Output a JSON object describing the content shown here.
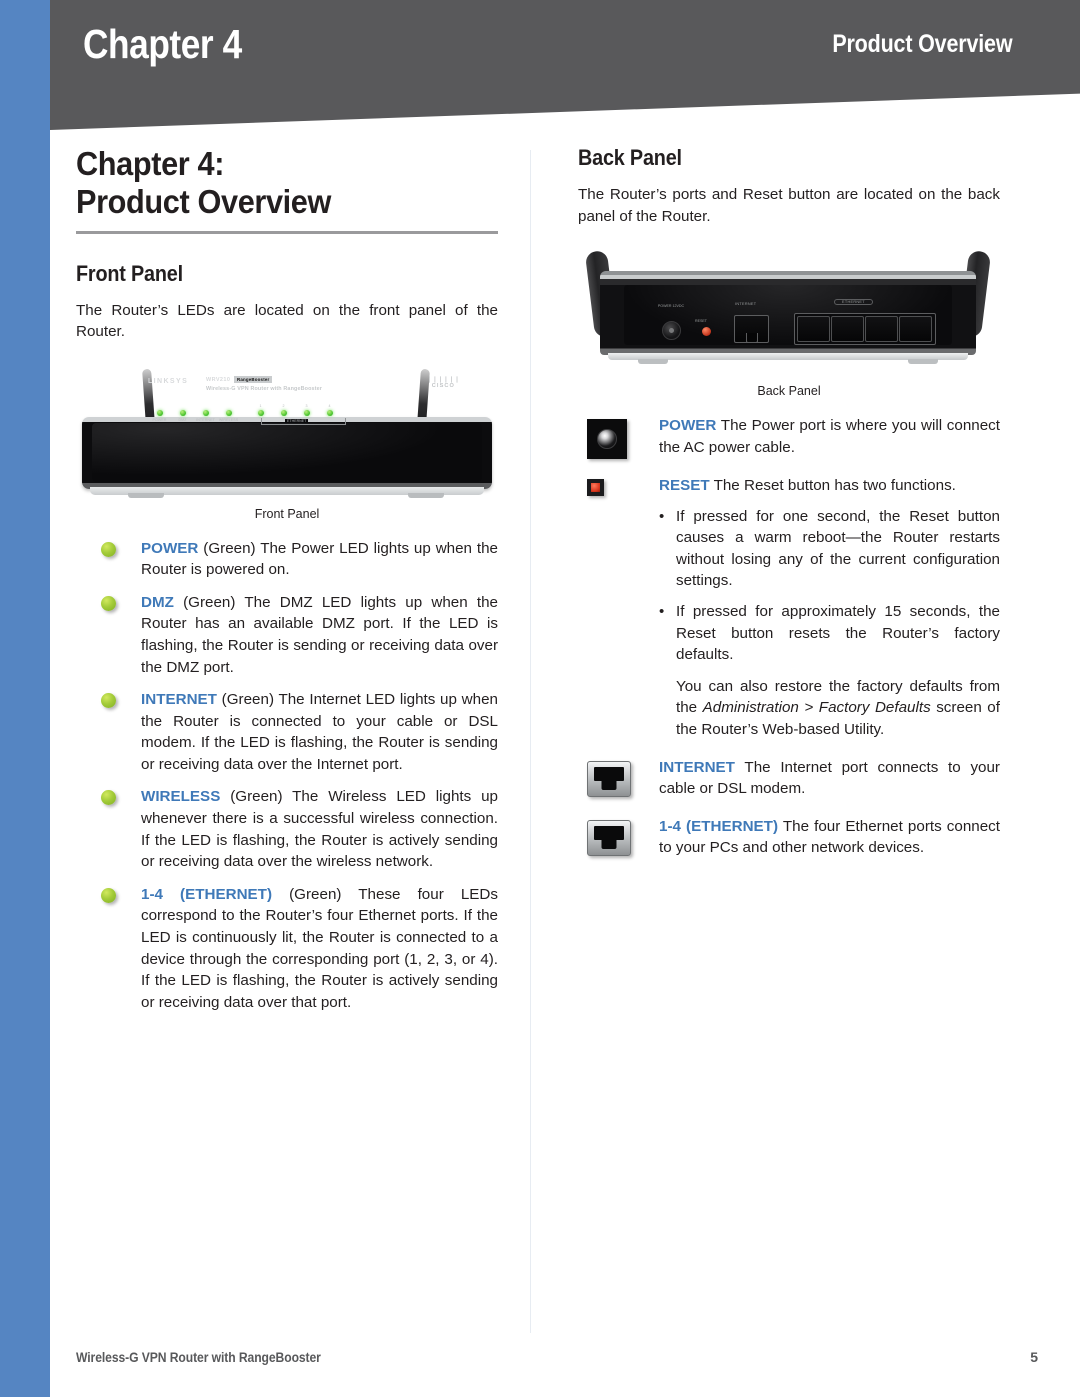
{
  "header": {
    "chapter": "Chapter 4",
    "section": "Product Overview"
  },
  "left_column": {
    "chapter_title_line1": "Chapter 4:",
    "chapter_title_line2": "Product Overview",
    "front_panel_heading": "Front Panel",
    "front_panel_intro": "The Router’s LEDs are located on the front panel of the Router.",
    "front_panel_caption": "Front Panel",
    "led_items": [
      {
        "label": "POWER",
        "text": " (Green)  The Power LED lights up when the Router is powered on."
      },
      {
        "label": "DMZ",
        "text": "  (Green)  The DMZ LED lights up when the Router has an available DMZ port. If the LED is flashing, the Router is sending or receiving data over the DMZ port."
      },
      {
        "label": "INTERNET",
        "text": " (Green) The Internet LED lights up when the Router is connected to your cable or DSL modem. If the LED is flashing, the Router is sending or receiving data over the Internet port."
      },
      {
        "label": "WIRELESS",
        "text": " (Green) The Wireless LED lights up whenever there is a successful wireless connection. If the LED is flashing, the Router is actively sending or receiving data over the wireless network."
      },
      {
        "label": "1-4  (ETHERNET)",
        "text": " (Green) These four LEDs correspond to the Router’s four Ethernet ports. If the LED is continuously lit, the Router is connected to a device through the corresponding port (1, 2, 3, or 4). If the LED is flashing, the Router is actively sending or receiving data over that port."
      }
    ]
  },
  "right_column": {
    "back_panel_heading": "Back Panel",
    "back_panel_intro": "The Router’s ports and Reset button are located on the back panel of the Router.",
    "back_panel_caption": "Back Panel",
    "port_items": [
      {
        "icon": "power-port-icon",
        "label": "POWER",
        "text": " The Power port is where you will connect the AC power cable."
      },
      {
        "icon": "reset-button-icon",
        "label": "RESET",
        "text": "  The Reset button has two functions."
      },
      {
        "icon": "rj45-internet-icon",
        "label": "INTERNET",
        "text": "  The Internet port connects to your cable or DSL modem."
      },
      {
        "icon": "rj45-ethernet-icon",
        "label": "1-4  (ETHERNET)",
        "text": " The four Ethernet ports connect to your PCs and other network devices."
      }
    ],
    "reset_bullets": [
      "If pressed for one second, the Reset button causes a warm reboot—the Router restarts without losing any of the current configuration settings.",
      "If pressed for approximately 15 seconds, the Reset button resets the Router’s factory defaults."
    ],
    "reset_note_pre": "You can also restore the factory defaults from  the  ",
    "reset_note_italic": "Administration > Factory Defaults",
    "reset_note_post": " screen of the Router’s Web-based Utility."
  },
  "front_panel_device": {
    "brand": "LINKSYS",
    "model": "WRV210",
    "badge": "RangeBooster",
    "tagline": "Wireless-G VPN Router with RangeBooster",
    "cisco_bars": "❘❘❘❘❘❘",
    "cisco_name": "CISCO",
    "led_labels": [
      "POWER",
      "DMZ",
      "INTERNET",
      "WIRELESS"
    ],
    "eth_numbers": [
      "1",
      "2",
      "3",
      "4"
    ],
    "eth_group_label": "ETHERNET"
  },
  "back_panel_device": {
    "power_label": "POWER 12VDC",
    "reset_label": "RESET",
    "internet_label": "INTERNET",
    "ethernet_label": "ETHERNET"
  },
  "footer": {
    "document_title": "Wireless-G VPN Router with RangeBooster",
    "page_number": "5"
  },
  "colors": {
    "accent_blue": "#3f79b8",
    "edge_stripe": "#5585c2",
    "banner_gray": "#59595b",
    "led_green": "#a4cc3a"
  }
}
